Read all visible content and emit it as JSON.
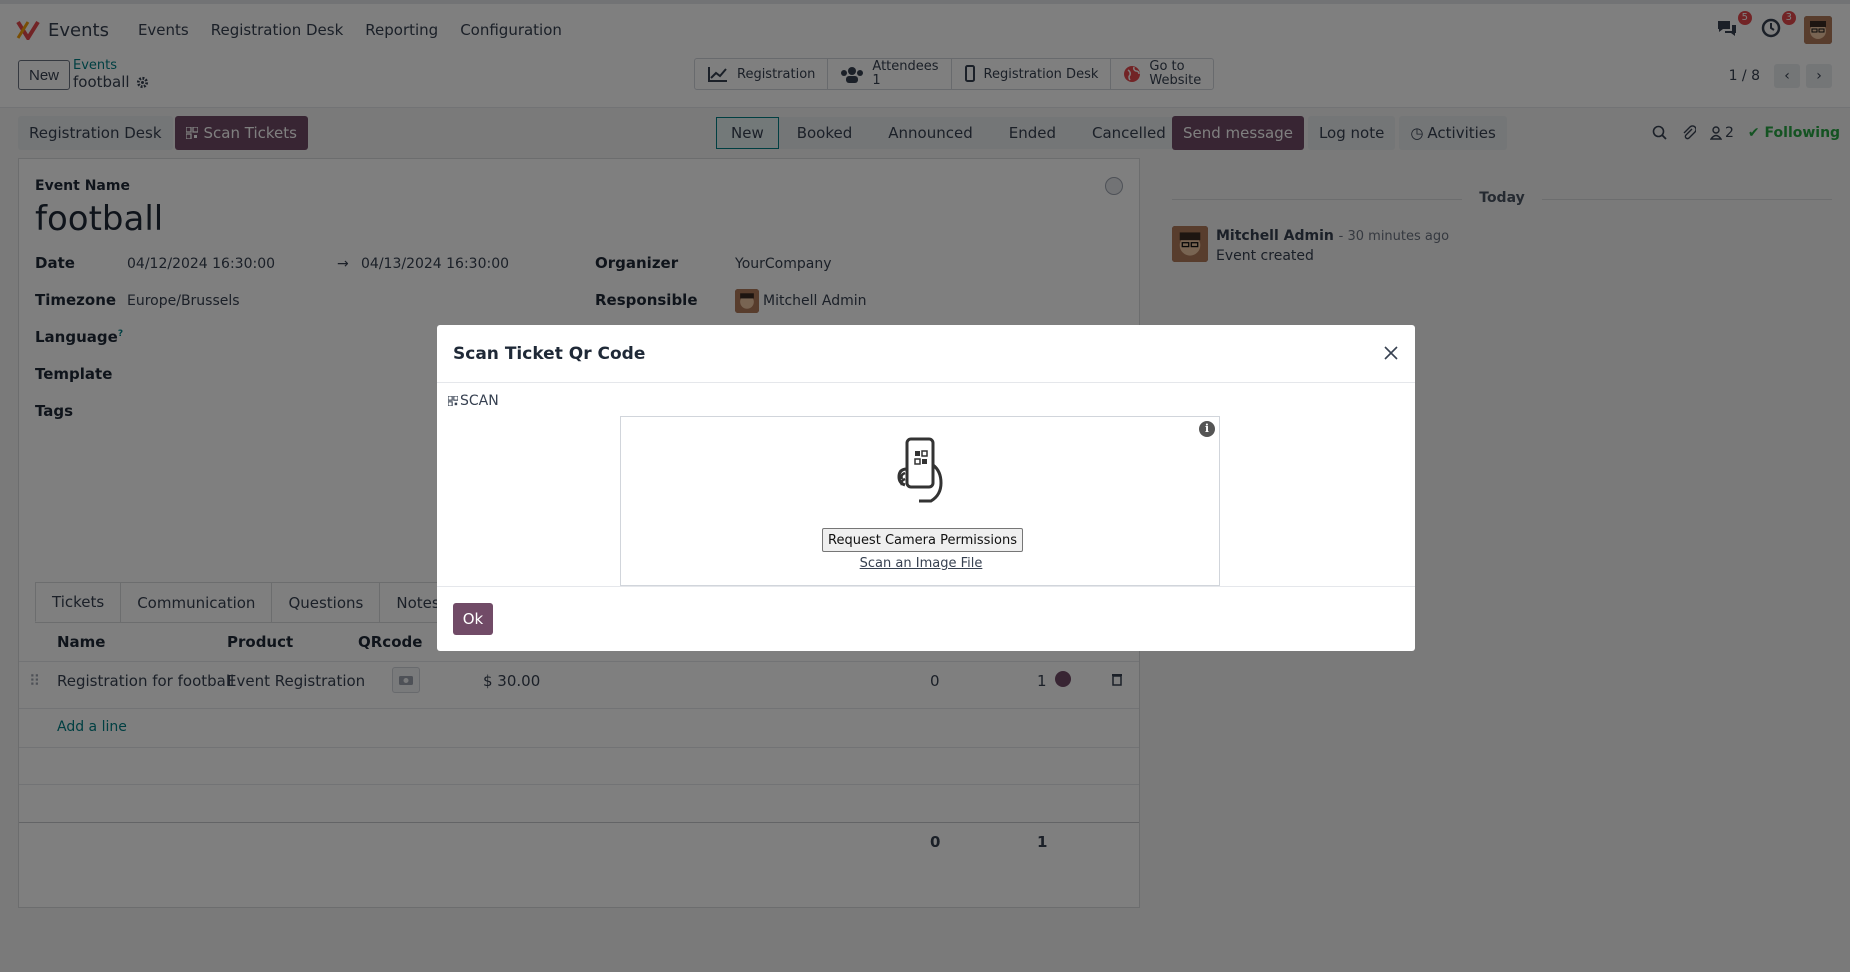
{
  "app": {
    "name": "Events"
  },
  "topmenu": [
    "Events",
    "Registration Desk",
    "Reporting",
    "Configuration"
  ],
  "systray": {
    "messages_count": "5",
    "activities_count": "3"
  },
  "control": {
    "new_label": "New",
    "breadcrumb_parent": "Events",
    "breadcrumb_current": "football",
    "smart_buttons": {
      "registration": "Registration",
      "attendees_label": "Attendees",
      "attendees_count": "1",
      "registration_desk": "Registration Desk",
      "go_to": "Go to",
      "website": "Website"
    },
    "pager": "1 / 8"
  },
  "form_header": {
    "registration_desk": "Registration Desk",
    "scan_tickets": "Scan Tickets"
  },
  "statusbar": [
    "New",
    "Booked",
    "Announced",
    "Ended",
    "Cancelled"
  ],
  "form": {
    "event_name_label": "Event Name",
    "event_name": "football",
    "date_label": "Date",
    "date_start": "04/12/2024 16:30:00",
    "date_end": "04/13/2024 16:30:00",
    "timezone_label": "Timezone",
    "timezone": "Europe/Brussels",
    "language_label": "Language",
    "template_label": "Template",
    "tags_label": "Tags",
    "organizer_label": "Organizer",
    "organizer": "YourCompany",
    "responsible_label": "Responsible",
    "responsible": "Mitchell Admin"
  },
  "tabs": [
    "Tickets",
    "Communication",
    "Questions",
    "Notes"
  ],
  "tickets": {
    "headers": {
      "name": "Name",
      "product": "Product",
      "qrcode": "QRcode"
    },
    "rows": [
      {
        "name": "Registration for football",
        "product": "Event Registration",
        "price": "$ 30.00",
        "col_a": "0",
        "col_b": "1"
      }
    ],
    "add_line": "Add a line",
    "totals": {
      "a": "0",
      "b": "1"
    }
  },
  "chatter": {
    "send_message": "Send message",
    "log_note": "Log note",
    "activities": "Activities",
    "followers_count": "2",
    "following": "Following",
    "date_separator": "Today",
    "message": {
      "author": "Mitchell Admin",
      "time": "- 30 minutes ago",
      "body": "Event created"
    }
  },
  "modal": {
    "title": "Scan Ticket Qr Code",
    "scan_label": "SCAN",
    "info": "i",
    "request_camera": "Request Camera Permissions",
    "scan_image_file": "Scan an Image File",
    "ok": "Ok"
  },
  "colors": {
    "brand": "#714b67",
    "link": "#017e84",
    "following": "#28a745",
    "badge": "#e5484d"
  }
}
